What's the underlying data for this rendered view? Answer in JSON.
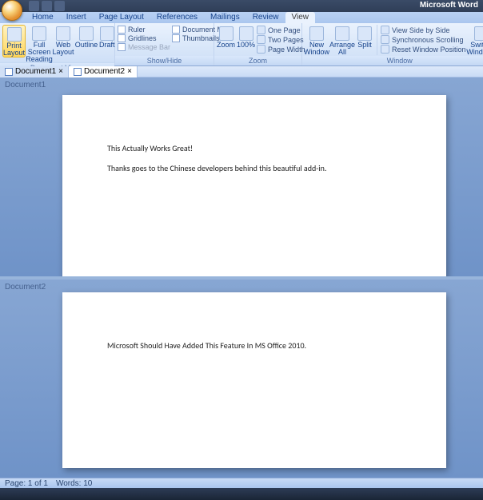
{
  "app_title": "Microsoft Word",
  "tabs": {
    "home": "Home",
    "insert": "Insert",
    "page_layout": "Page Layout",
    "references": "References",
    "mailings": "Mailings",
    "review": "Review",
    "view": "View"
  },
  "ribbon": {
    "document_views": {
      "label": "Document Views",
      "print_layout": "Print Layout",
      "full_screen_reading": "Full Screen Reading",
      "web_layout": "Web Layout",
      "outline": "Outline",
      "draft": "Draft"
    },
    "show_hide": {
      "label": "Show/Hide",
      "ruler": "Ruler",
      "gridlines": "Gridlines",
      "message_bar": "Message Bar",
      "document_map": "Document Map",
      "thumbnails": "Thumbnails"
    },
    "zoom": {
      "label": "Zoom",
      "zoom": "Zoom",
      "hundred": "100%",
      "one_page": "One Page",
      "two_pages": "Two Pages",
      "page_width": "Page Width"
    },
    "window": {
      "label": "Window",
      "new_window": "New Window",
      "arrange_all": "Arrange All",
      "split": "Split",
      "side_by_side": "View Side by Side",
      "sync_scroll": "Synchronous Scrolling",
      "reset_pos": "Reset Window Position",
      "switch_windows": "Switch Windows"
    }
  },
  "doc_tabs": {
    "doc1": "Document1",
    "doc2": "Document2"
  },
  "panes": {
    "first": {
      "label": "Document1",
      "line1": "This Actually Works Great!",
      "line2": "Thanks goes to the Chinese developers behind this beautiful add-in."
    },
    "second": {
      "label": "Document2",
      "line1": "Microsoft Should Have Added This Feature In MS Office 2010."
    }
  },
  "status": {
    "page": "Page: 1 of 1",
    "words": "Words: 10"
  }
}
